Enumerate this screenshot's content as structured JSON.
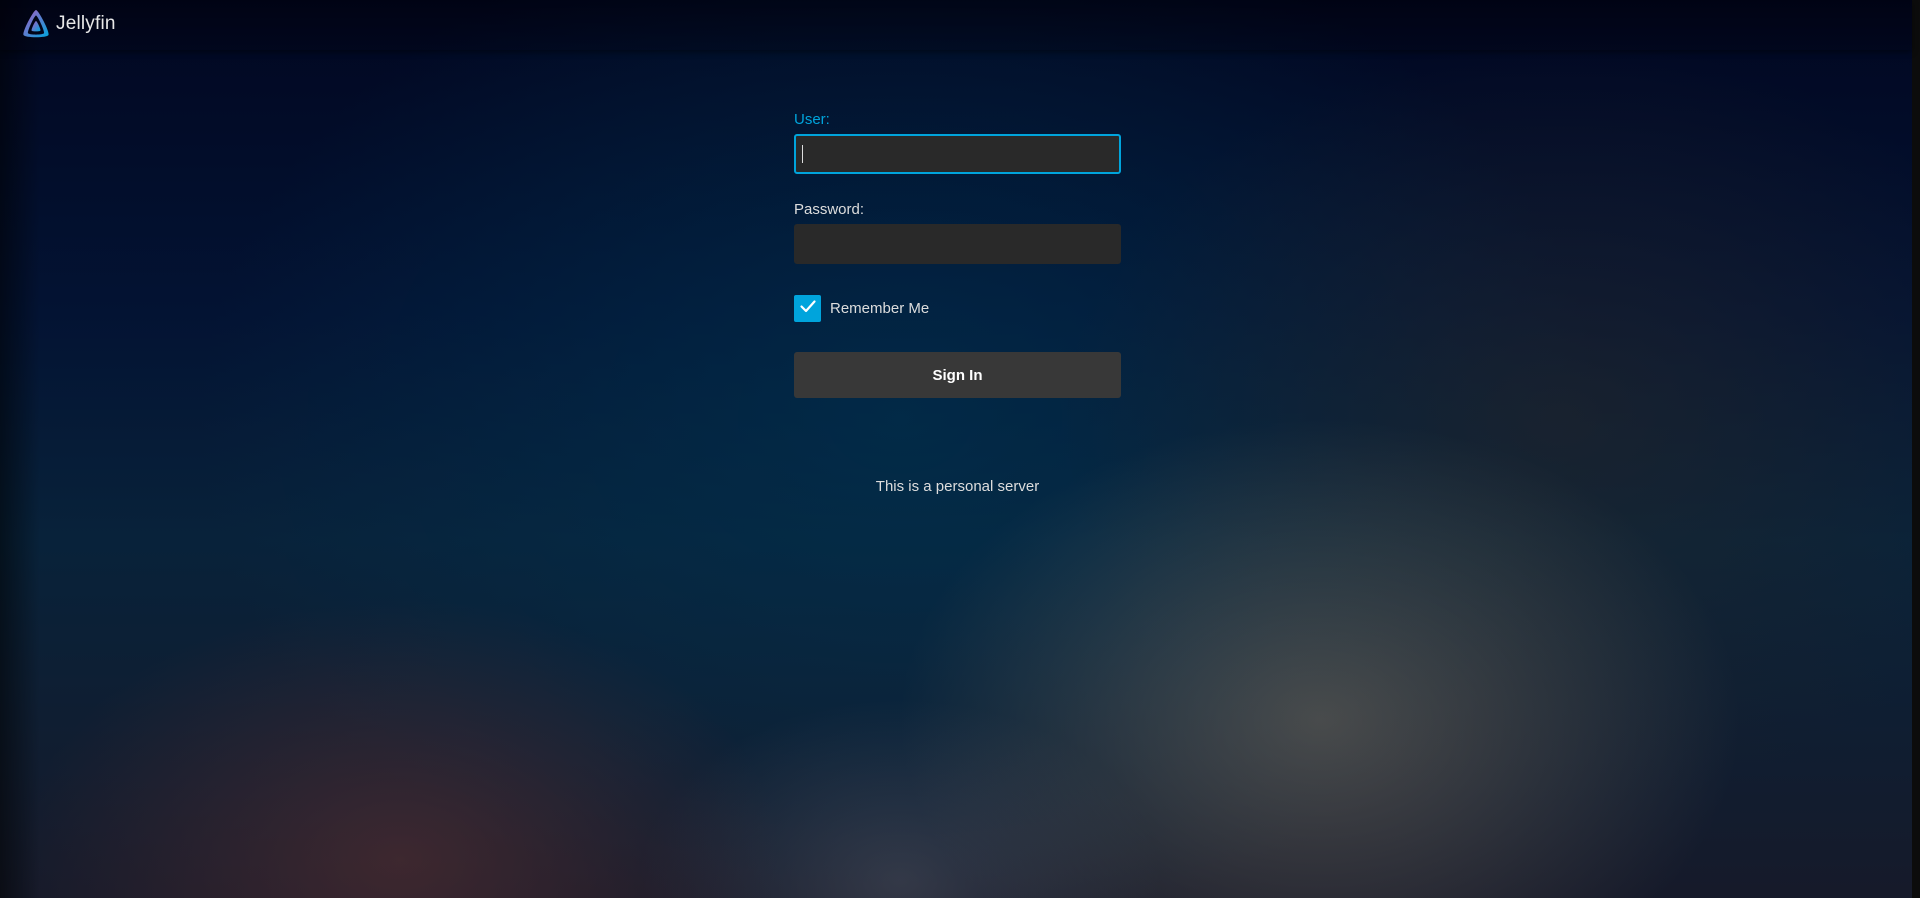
{
  "app": {
    "name": "Jellyfin",
    "logo_icon": "jellyfin-logo-icon"
  },
  "login": {
    "user_label": "User:",
    "user_value": "",
    "password_label": "Password:",
    "password_value": "",
    "remember_label": "Remember Me",
    "remember_checked": true,
    "signin_label": "Sign In"
  },
  "footer": {
    "disclaimer": "This is a personal server"
  },
  "colors": {
    "accent": "#00a4dc",
    "input_bg": "#292929",
    "button_bg": "#383838"
  }
}
